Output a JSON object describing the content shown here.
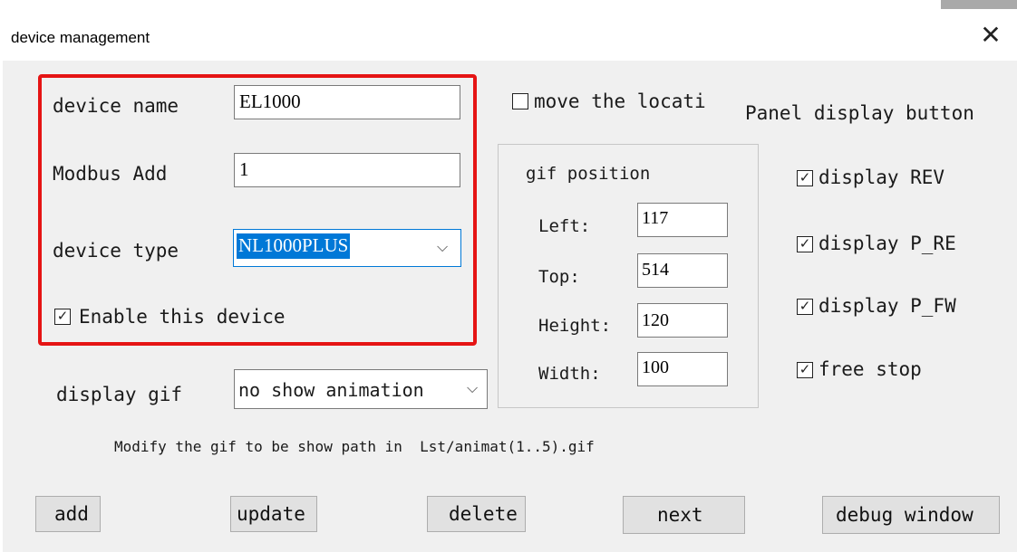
{
  "window": {
    "title": "device management",
    "close_glyph": "✕"
  },
  "device": {
    "name_label": "device name",
    "name_value": "EL1000",
    "modbus_label": "Modbus Add",
    "modbus_value": "1",
    "type_label": "device type",
    "type_value": "NL1000PLUS",
    "enable_label": "Enable this device",
    "enable_checked": true
  },
  "move_location": {
    "label": "move the locati",
    "checked": false
  },
  "panel": {
    "title": "Panel display button",
    "options": [
      {
        "label": "display REV",
        "checked": true
      },
      {
        "label": "display P_RE",
        "checked": true
      },
      {
        "label": "display P_FW",
        "checked": true
      },
      {
        "label": "free stop",
        "checked": true
      }
    ]
  },
  "gif_position": {
    "title": "gif position",
    "left_label": "Left:",
    "left_value": "117",
    "top_label": "Top:",
    "top_value": "514",
    "height_label": "Height:",
    "height_value": "120",
    "width_label": "Width:",
    "width_value": "100"
  },
  "display_gif": {
    "label": "display gif",
    "value": "no show animation"
  },
  "hint": "Modify the gif to be show path in  Lst/animat(1..5).gif",
  "buttons": {
    "add": "add",
    "update": "update",
    "delete": "delete",
    "next": "next",
    "debug": "debug window"
  },
  "colors": {
    "highlight": "#e51414",
    "selection": "#0078d7",
    "window_bg": "#f0f0f0"
  },
  "icons": {
    "close": "close-icon",
    "checkbox": "checkbox-icon",
    "dropdown": "chevron-down-icon"
  }
}
